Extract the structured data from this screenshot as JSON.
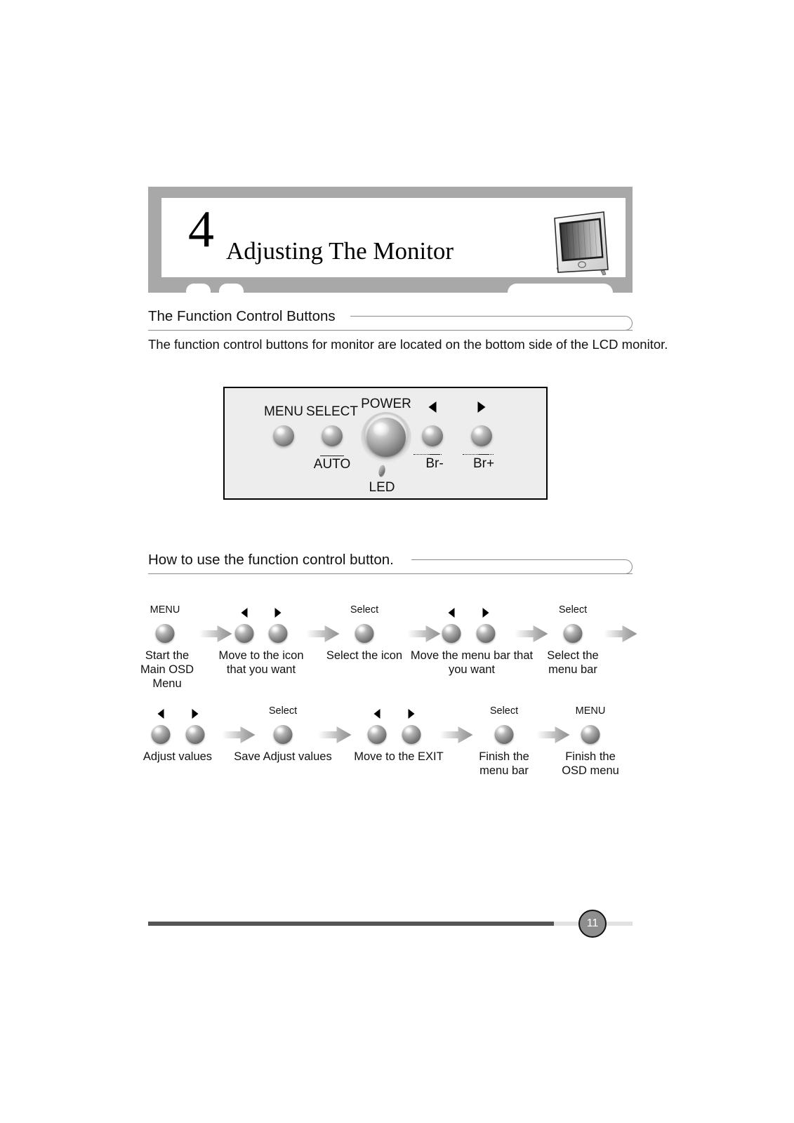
{
  "chapter": {
    "number": "4",
    "title": "Adjusting The Monitor",
    "illustration_icon": "lcd-monitor-icon"
  },
  "sections": [
    {
      "heading": "The Function Control Buttons",
      "body": "The function control buttons for monitor are located on the bottom side of the LCD monitor."
    },
    {
      "heading": "How to use the function control button."
    }
  ],
  "control_panel": {
    "buttons": [
      {
        "label": "MENU",
        "sub": "",
        "icon": "round-push-button"
      },
      {
        "label": "SELECT",
        "sub": "AUTO",
        "icon": "round-push-button"
      },
      {
        "label": "POWER",
        "sub": "",
        "icon": "round-power-button"
      },
      {
        "label": "left-arrow-icon",
        "sub": "Br-",
        "icon": "round-push-button"
      },
      {
        "label": "right-arrow-icon",
        "sub": "Br+",
        "icon": "round-push-button"
      }
    ],
    "led_label": "LED",
    "led_icon": "led-indicator-icon"
  },
  "flow": {
    "row1": [
      {
        "top": "MENU",
        "icons": [
          "button"
        ],
        "caption": "Start the\nMain OSD\nMenu"
      },
      {
        "top": "",
        "icons": [
          "left",
          "right"
        ],
        "caption": "Move to the icon\nthat you want"
      },
      {
        "top": "Select",
        "icons": [
          "button"
        ],
        "caption": "Select the icon"
      },
      {
        "top": "",
        "icons": [
          "left",
          "right"
        ],
        "caption": "Move the menu bar that\nyou want"
      },
      {
        "top": "Select",
        "icons": [
          "button"
        ],
        "caption": "Select the\nmenu bar"
      }
    ],
    "row2": [
      {
        "top": "",
        "icons": [
          "left",
          "right"
        ],
        "caption": "Adjust values"
      },
      {
        "top": "Select",
        "icons": [
          "button"
        ],
        "caption": "Save Adjust values"
      },
      {
        "top": "",
        "icons": [
          "left",
          "right"
        ],
        "caption": "Move to the EXIT"
      },
      {
        "top": "Select",
        "icons": [
          "button"
        ],
        "caption": "Finish the\nmenu bar"
      },
      {
        "top": "MENU",
        "icons": [
          "button"
        ],
        "caption": "Finish the\nOSD menu"
      }
    ]
  },
  "footer": {
    "page_number": "11"
  },
  "colors": {
    "header_frame": "#a8a8a8",
    "panel_fill": "#ededed",
    "rule": "#8a8a8a",
    "footer_dark": "#555555",
    "footer_light": "#e2e2e2",
    "badge": "#8e8e8e"
  }
}
